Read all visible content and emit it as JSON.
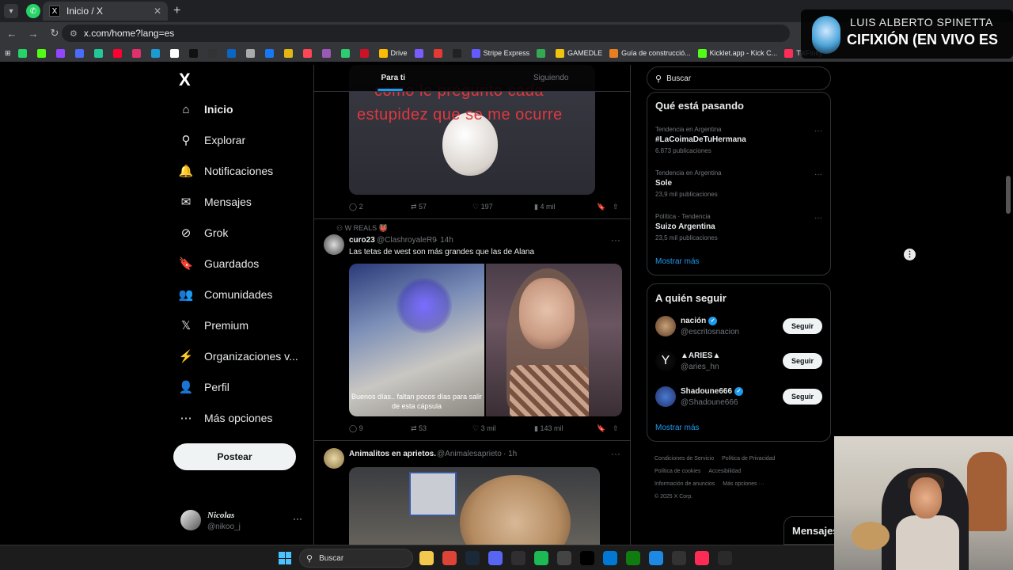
{
  "browser": {
    "tab_title": "Inicio / X",
    "tab_favicon": "X",
    "new_tab": "+",
    "url": "x.com/home?lang=es",
    "bookmarks": [
      {
        "label": "",
        "color": "#25d366"
      },
      {
        "label": "",
        "color": "#53fc18"
      },
      {
        "label": "",
        "color": "#9146ff"
      },
      {
        "label": "",
        "color": "#4a6cf7"
      },
      {
        "label": "",
        "color": "#20c997"
      },
      {
        "label": "",
        "color": "#ff0033"
      },
      {
        "label": "",
        "color": "#e1306c"
      },
      {
        "label": "",
        "color": "#1b9bd1"
      },
      {
        "label": "",
        "color": "#ffffff"
      },
      {
        "label": "",
        "color": "#111111"
      },
      {
        "label": "",
        "color": "#333333"
      },
      {
        "label": "",
        "color": "#0a66c2"
      },
      {
        "label": "",
        "color": "#aaaaaa"
      },
      {
        "label": "",
        "color": "#1877f2"
      },
      {
        "label": "",
        "color": "#e2b714"
      },
      {
        "label": "",
        "color": "#ff4655"
      },
      {
        "label": "",
        "color": "#9b59b6"
      },
      {
        "label": "",
        "color": "#2ecc71"
      },
      {
        "label": "",
        "color": "#ce1126"
      },
      {
        "label": "Drive",
        "color": "#fbbc04"
      },
      {
        "label": "",
        "color": "#7a5cff"
      },
      {
        "label": "",
        "color": "#e53935"
      },
      {
        "label": "",
        "color": "#222222"
      },
      {
        "label": "Stripe Express",
        "color": "#635bff"
      },
      {
        "label": "",
        "color": "#34a853"
      },
      {
        "label": "GAMEDLE",
        "color": "#f1c40f"
      },
      {
        "label": "Guía de construcció...",
        "color": "#e67e22"
      },
      {
        "label": "Kicklet.app - Kick C...",
        "color": "#53fc18"
      },
      {
        "label": "TikFinity",
        "color": "#ff2d55"
      }
    ]
  },
  "now_playing": {
    "artist": "LUIS ALBERTO SPINETTA",
    "song": "CIFIXIÓN (EN VIVO ES"
  },
  "sidebar": {
    "logo": "X",
    "items": [
      {
        "label": "Inicio",
        "icon": "home-icon",
        "glyph": "⌂",
        "active": true
      },
      {
        "label": "Explorar",
        "icon": "search-icon",
        "glyph": "⚲"
      },
      {
        "label": "Notificaciones",
        "icon": "bell-icon",
        "glyph": "🔔"
      },
      {
        "label": "Mensajes",
        "icon": "mail-icon",
        "glyph": "✉"
      },
      {
        "label": "Grok",
        "icon": "grok-icon",
        "glyph": "⊘"
      },
      {
        "label": "Guardados",
        "icon": "bookmark-icon",
        "glyph": "🔖"
      },
      {
        "label": "Comunidades",
        "icon": "communities-icon",
        "glyph": "👥"
      },
      {
        "label": "Premium",
        "icon": "x-premium-icon",
        "glyph": "𝕏"
      },
      {
        "label": "Organizaciones v...",
        "icon": "lightning-icon",
        "glyph": "⚡"
      },
      {
        "label": "Perfil",
        "icon": "person-icon",
        "glyph": "👤"
      },
      {
        "label": "Más opciones",
        "icon": "more-circle-icon",
        "glyph": "⋯"
      }
    ],
    "post_button": "Postear",
    "account": {
      "name": "Nicolas",
      "handle": "@nikoo_j",
      "more": "···"
    }
  },
  "timeline": {
    "tabs": [
      {
        "label": "Para ti",
        "active": true
      },
      {
        "label": "Siguiendo",
        "active": false
      }
    ],
    "post1": {
      "caption_line1": "como le pregunto cada",
      "caption_line2": "estupidez que se me ocurre",
      "replies": "2",
      "reposts": "57",
      "likes": "197",
      "views": "4 mil"
    },
    "post2": {
      "context": "W REALS 👹",
      "name": "curo23",
      "handle": "@ClashroyaleR9",
      "time": "· 14h",
      "text": "Las tetas de west son más grandes que las de Alana",
      "image_caption": "Buenos días.. faltan pocos días para salir de esta cápsula",
      "replies": "9",
      "reposts": "53",
      "likes": "3 mil",
      "views": "143 mil"
    },
    "post3": {
      "name": "Animalitos en aprietos.",
      "handle": "@Animalesaprieto",
      "time": "· 1h"
    }
  },
  "right": {
    "search_placeholder": "Buscar",
    "trends_title": "Qué está pasando",
    "trends": [
      {
        "category": "Tendencia en Argentina",
        "name": "#LaCoimaDeTuHermana",
        "count": "6.873 publicaciones"
      },
      {
        "category": "Tendencia en Argentina",
        "name": "Sole",
        "count": "23,9 mil publicaciones"
      },
      {
        "category": "Política · Tendencia",
        "name": "Suizo Argentina",
        "count": "23,5 mil publicaciones"
      }
    ],
    "show_more": "Mostrar más",
    "follow_title": "A quién seguir",
    "follow": [
      {
        "name": "nación",
        "handle": "@escritosnacion",
        "verified": true,
        "button": "Seguir"
      },
      {
        "name": "▲ARIES▲",
        "handle": "@aries_hn",
        "verified": false,
        "button": "Seguir"
      },
      {
        "name": "Shadoune666",
        "handle": "@Shadoune666",
        "verified": true,
        "button": "Seguir"
      }
    ],
    "follow_more": "Mostrar más",
    "footer": [
      "Condiciones de Servicio",
      "Política de Privacidad",
      "Política de cookies",
      "Accesibilidad",
      "Información de anuncios",
      "Más opciones ···",
      "© 2025 X Corp."
    ],
    "messages_drawer": "Mensajes"
  },
  "taskbar": {
    "search": "Buscar",
    "apps": [
      {
        "icon": "file-explorer-icon",
        "color": "#f2c94c"
      },
      {
        "icon": "chrome-icon",
        "color": "#db4437"
      },
      {
        "icon": "steam-icon",
        "color": "#1b2838"
      },
      {
        "icon": "discord-icon",
        "color": "#5865f2"
      },
      {
        "icon": "obs-icon",
        "color": "#302e31"
      },
      {
        "icon": "spotify-icon",
        "color": "#1db954"
      },
      {
        "icon": "calculator-icon",
        "color": "#444444"
      },
      {
        "icon": "capcut-icon",
        "color": "#000000"
      },
      {
        "icon": "outlook-icon",
        "color": "#0078d4"
      },
      {
        "icon": "xbox-icon",
        "color": "#107c10"
      },
      {
        "icon": "settings-icon",
        "color": "#1e88e5"
      },
      {
        "icon": "app-icon",
        "color": "#333333"
      },
      {
        "icon": "tiktok-icon",
        "color": "#fe2c55"
      },
      {
        "icon": "epic-games-icon",
        "color": "#2a2a2a"
      }
    ]
  }
}
